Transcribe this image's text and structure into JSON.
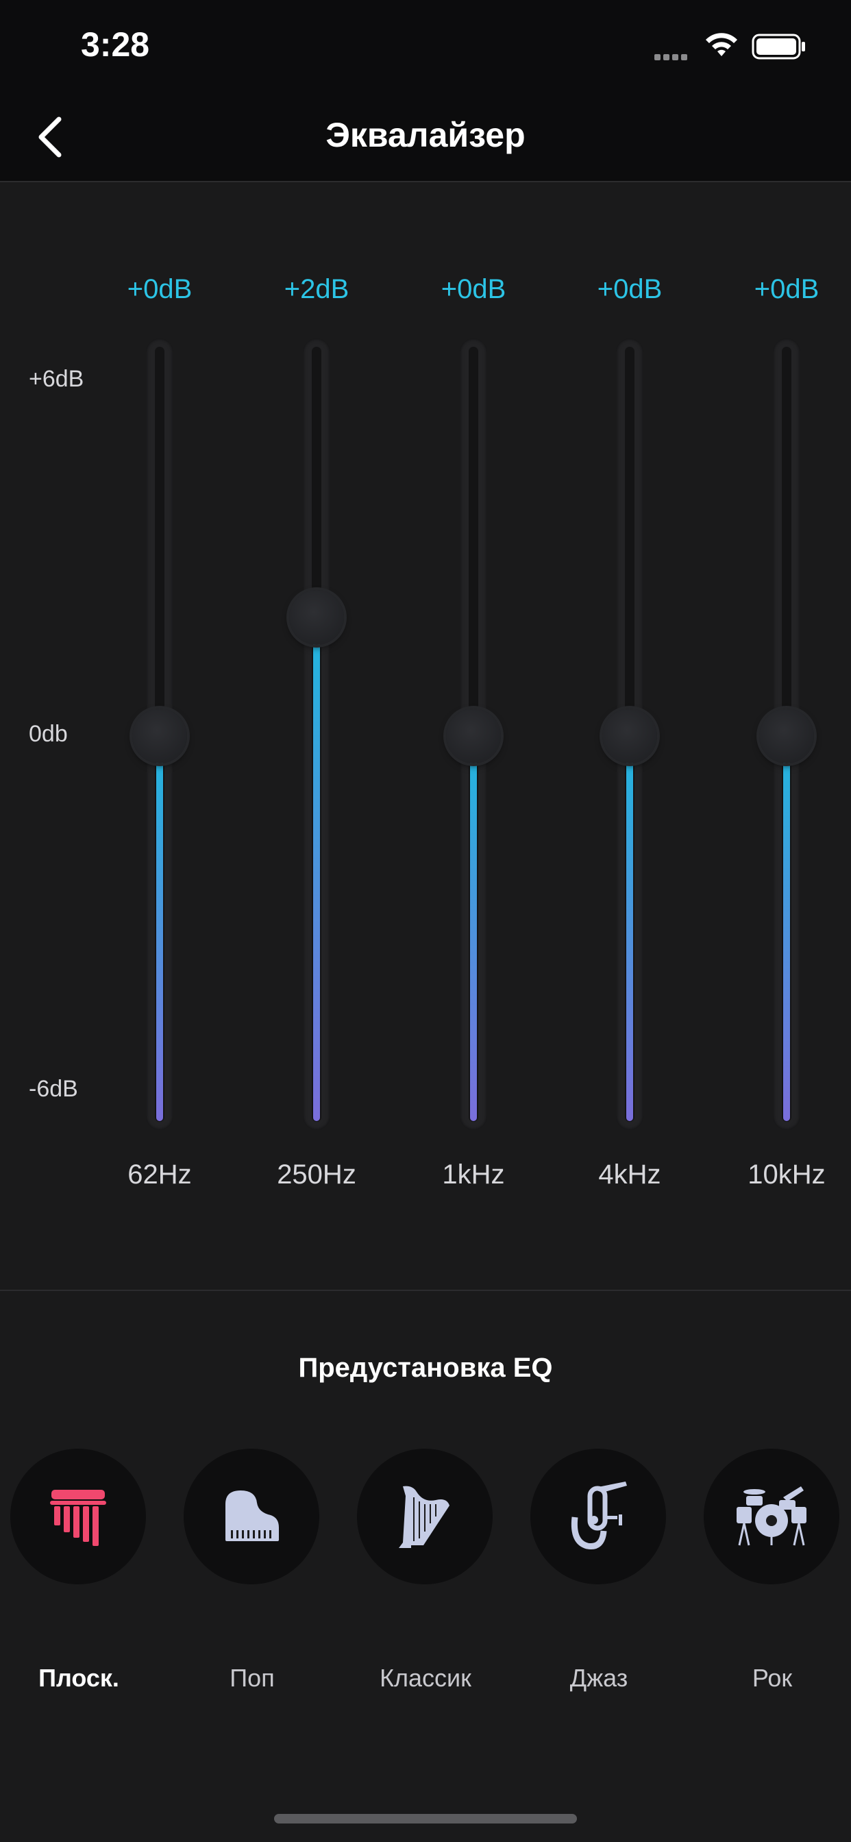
{
  "status_bar": {
    "time": "3:28"
  },
  "nav": {
    "title": "Эквалайзер",
    "back_icon": "chevron-left-icon"
  },
  "scale": {
    "top": "+6dB",
    "middle": "0db",
    "bottom": "-6dB",
    "range_db": [
      -6,
      6
    ]
  },
  "bands": [
    {
      "freq": "62Hz",
      "value_label": "+0dB",
      "gain_db": 0
    },
    {
      "freq": "250Hz",
      "value_label": "+2dB",
      "gain_db": 2
    },
    {
      "freq": "1kHz",
      "value_label": "+0dB",
      "gain_db": 0
    },
    {
      "freq": "4kHz",
      "value_label": "+0dB",
      "gain_db": 0
    },
    {
      "freq": "10kHz",
      "value_label": "+0dB",
      "gain_db": 0
    }
  ],
  "presets": {
    "title": "Предустановка EQ",
    "items": [
      {
        "label": "Плоск.",
        "icon": "chimes-icon",
        "active": true
      },
      {
        "label": "Поп",
        "icon": "piano-icon",
        "active": false
      },
      {
        "label": "Классик",
        "icon": "harp-icon",
        "active": false
      },
      {
        "label": "Джаз",
        "icon": "tuba-icon",
        "active": false
      },
      {
        "label": "Рок",
        "icon": "drums-icon",
        "active": false
      }
    ]
  },
  "colors": {
    "accent_value": "#2cc4e6",
    "fill_top": "#1fb8de",
    "fill_bottom": "#7a6edb",
    "active_preset_icon": "#f0486e",
    "inactive_preset_icon": "#c6cde6"
  }
}
